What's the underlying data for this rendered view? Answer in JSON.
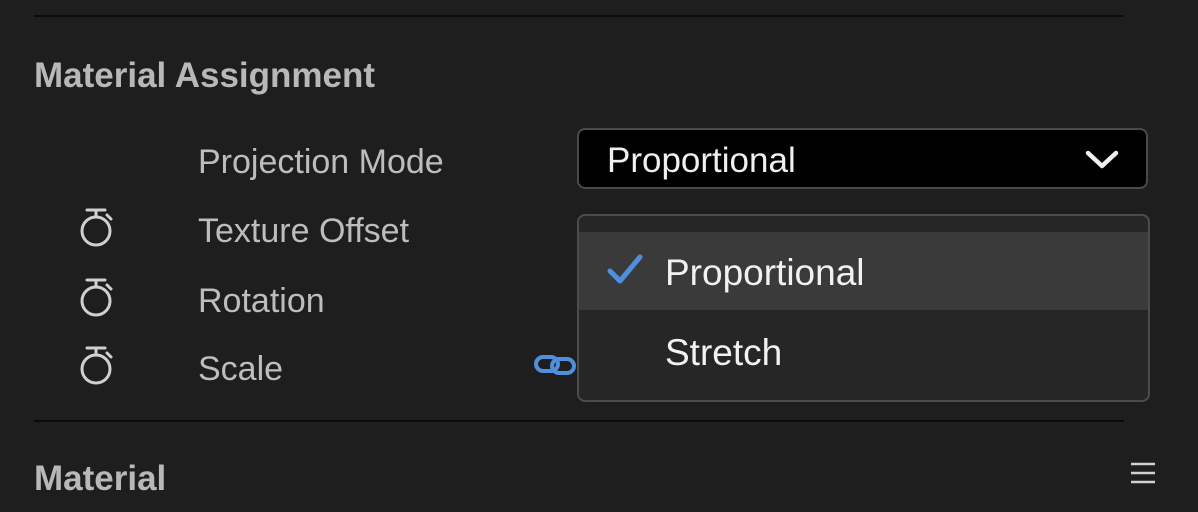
{
  "sections": {
    "material_assignment": {
      "title": "Material Assignment",
      "properties": [
        {
          "label": "Projection Mode",
          "icon": "none"
        },
        {
          "label": "Texture Offset",
          "icon": "stopwatch-icon"
        },
        {
          "label": "Rotation",
          "icon": "stopwatch-icon"
        },
        {
          "label": "Scale",
          "icon": "stopwatch-icon"
        }
      ]
    },
    "material": {
      "title": "Material",
      "menu_icon": "hamburger-menu-icon"
    }
  },
  "projection_dropdown": {
    "selected": "Proportional",
    "open": true,
    "options": [
      {
        "label": "Proportional",
        "checked": true
      },
      {
        "label": "Stretch",
        "checked": false
      }
    ]
  },
  "scale_link_icon": "link-icon",
  "colors": {
    "background": "#1e1e1e",
    "accent_blue": "#4f8fdd",
    "menu_highlight": "#3a3a3a"
  }
}
